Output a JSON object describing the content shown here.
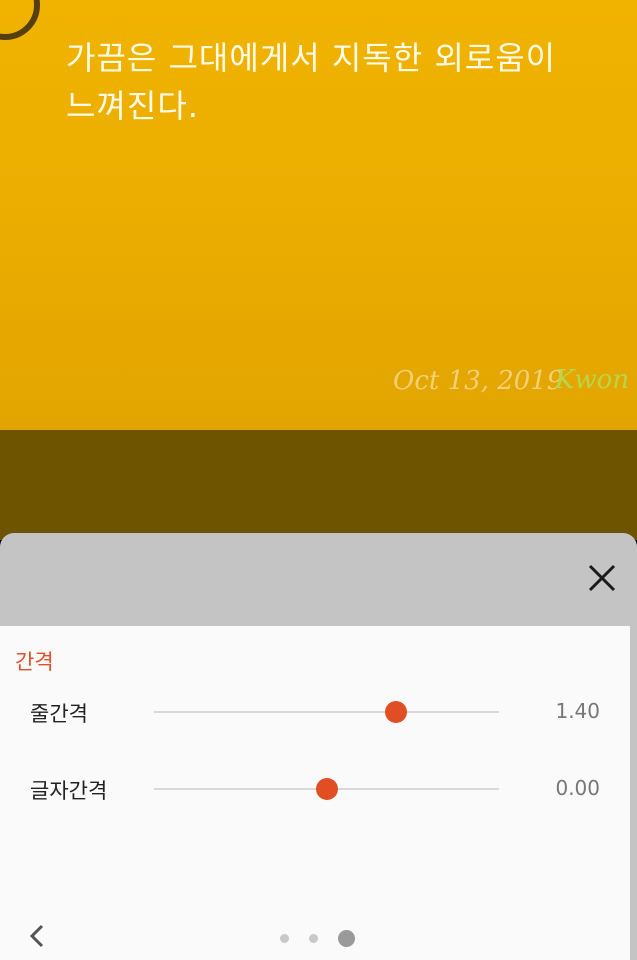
{
  "card": {
    "quote": "가끔은 그대에게서 지독한 외로움이 느껴진다.",
    "date": "Oct 13, 2019",
    "signature": "Kwon"
  },
  "sheet": {
    "close_icon": "close-icon",
    "section_title": "간격",
    "sliders": [
      {
        "label": "줄간격",
        "value_text": "1.40",
        "level": 0.7
      },
      {
        "label": "글자간격",
        "value_text": "0.00",
        "level": 0.5
      }
    ],
    "back_icon": "chevron-left-icon",
    "pager": {
      "count": 3,
      "active": 3
    }
  },
  "colors": {
    "accent": "#e24e24",
    "card_yellow": "#eeb000",
    "section_title": "#e0502a"
  }
}
